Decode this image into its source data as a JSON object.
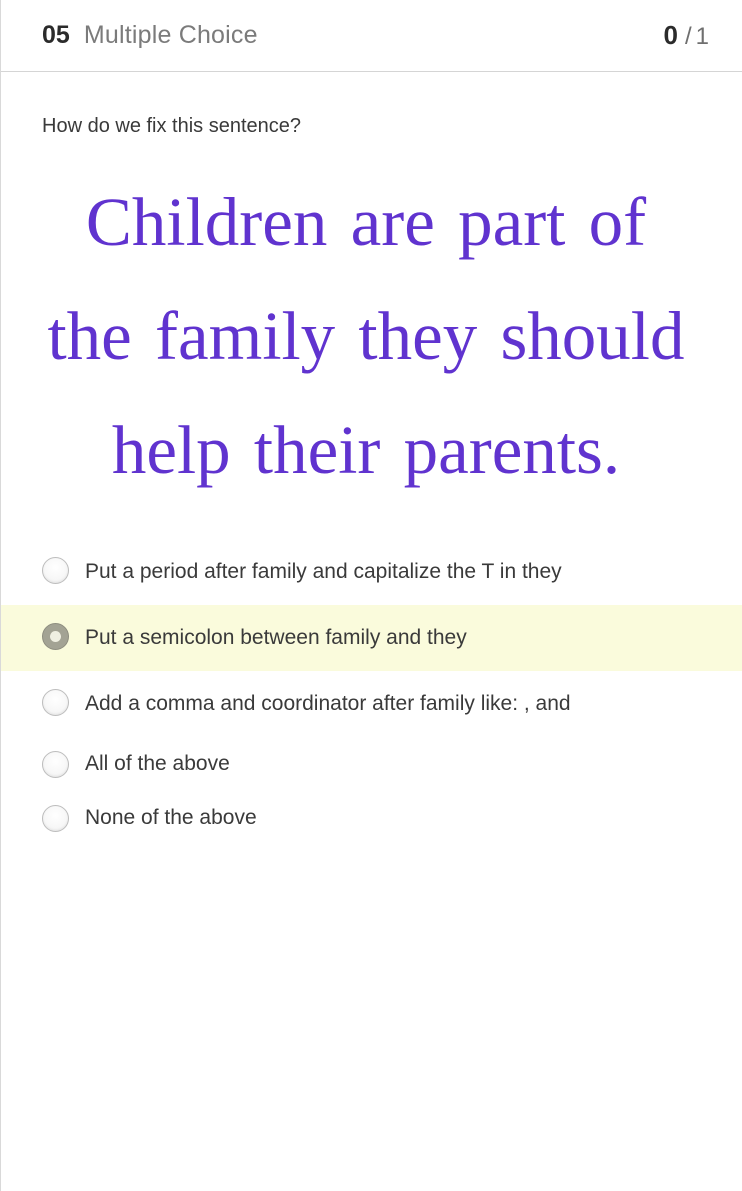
{
  "header": {
    "question_number": "05",
    "question_type": "Multiple Choice",
    "score_earned": "0",
    "score_separator": "/",
    "score_total": "1"
  },
  "question": {
    "prompt": "How do we fix this sentence?",
    "sentence": "Children are part of the family they should help their parents."
  },
  "choices": [
    {
      "label": "Put a period after family and capitalize the T in they",
      "selected": false,
      "multiline": true
    },
    {
      "label": "Put a semicolon between family and they",
      "selected": true,
      "multiline": true
    },
    {
      "label": "Add a comma and coordinator after family like: , and",
      "selected": false,
      "multiline": true
    },
    {
      "label": "All of the above",
      "selected": false,
      "multiline": false
    },
    {
      "label": "None of the above",
      "selected": false,
      "multiline": false
    }
  ],
  "colors": {
    "sentence_purple": "#6033cf",
    "selected_highlight": "#fafbdc",
    "selected_radio": "#a3a394",
    "text_dark": "#3a3a3a",
    "text_muted": "#7b7b7b",
    "divider": "#d5d5d5"
  }
}
